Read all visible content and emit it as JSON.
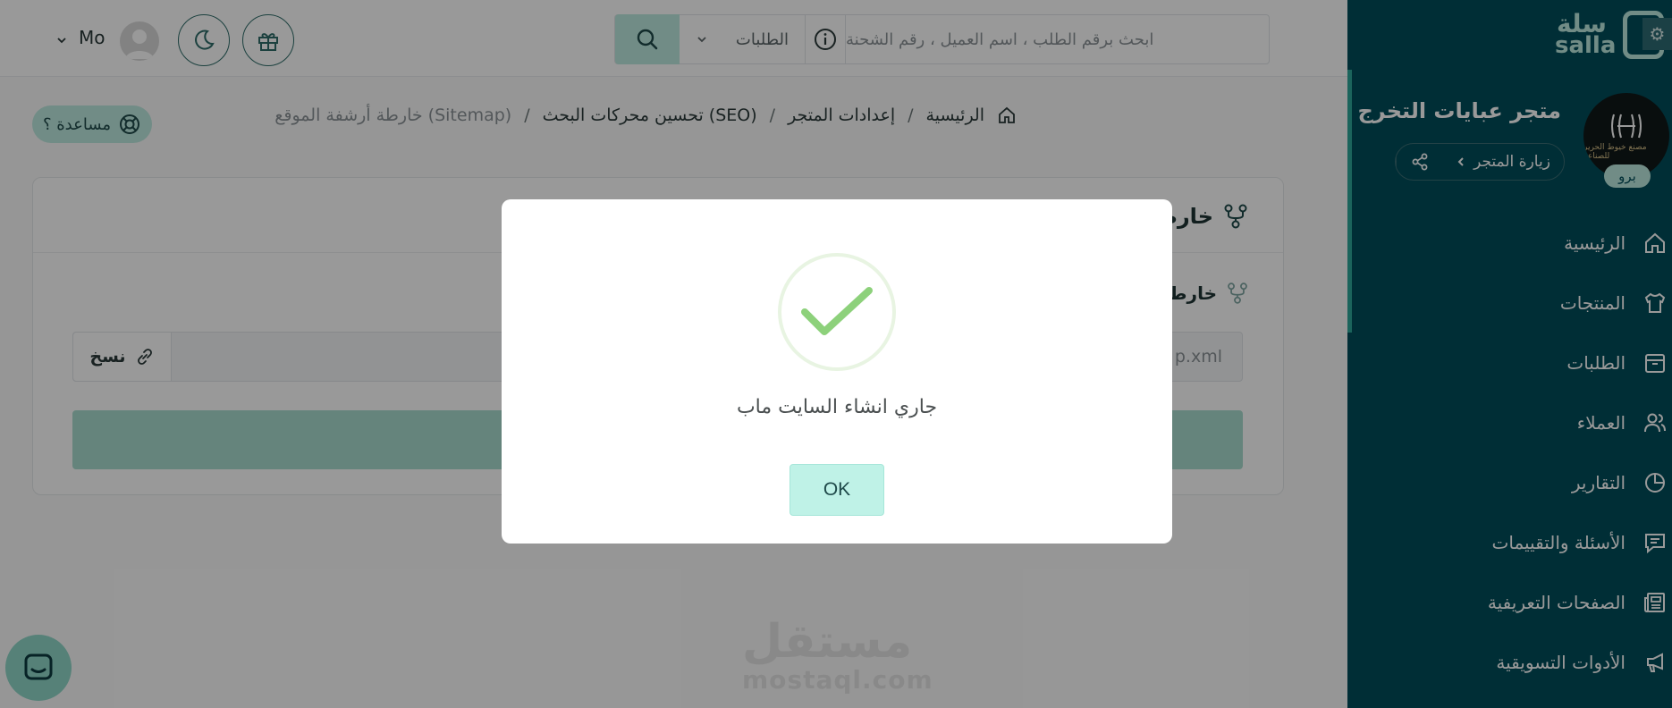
{
  "topbar": {
    "search_placeholder": "ابحث برقم الطلب ، اسم العميل ، رقم الشحنة",
    "search_scope": "الطلبات",
    "user_name": "Mo"
  },
  "help": {
    "label": "مساعدة ؟"
  },
  "breadcrumb": {
    "home": "الرئيسية",
    "settings": "إعدادات المتجر",
    "seo": "تحسين محركات البحث (SEO)",
    "current": "خارطة أرشفة الموقع (Sitemap)",
    "separator": "/"
  },
  "card": {
    "title": "خارطة",
    "subtitle": "خارط",
    "url_value": "p.xml",
    "copy_label": "نسخ"
  },
  "watermark": {
    "arabic": "مستقل",
    "english": "mostaql.com"
  },
  "sidebar": {
    "logo_ar": "سلة",
    "logo_en": "salla",
    "store_logo_text": "مصنع خيوط الحرير للصناعة",
    "store_name": "متجر عبايات التخرج",
    "plan_badge": "برو",
    "visit_store": "زيارة المتجر",
    "nav": [
      {
        "label": "الرئيسية",
        "icon": "home-icon"
      },
      {
        "label": "المنتجات",
        "icon": "shirt-icon"
      },
      {
        "label": "الطلبات",
        "icon": "box-icon"
      },
      {
        "label": "العملاء",
        "icon": "users-icon"
      },
      {
        "label": "التقارير",
        "icon": "pie-chart-icon"
      },
      {
        "label": "الأسئلة والتقييمات",
        "icon": "comment-icon"
      },
      {
        "label": "الصفحات التعريفية",
        "icon": "newspaper-icon"
      },
      {
        "label": "الأدوات التسويقية",
        "icon": "megaphone-icon"
      }
    ]
  },
  "modal": {
    "message": "جاري انشاء السايت ماب",
    "ok_label": "OK"
  },
  "colors": {
    "sidebar": "#004d5a",
    "accent": "#bde9df",
    "success": "#8dd17b"
  }
}
